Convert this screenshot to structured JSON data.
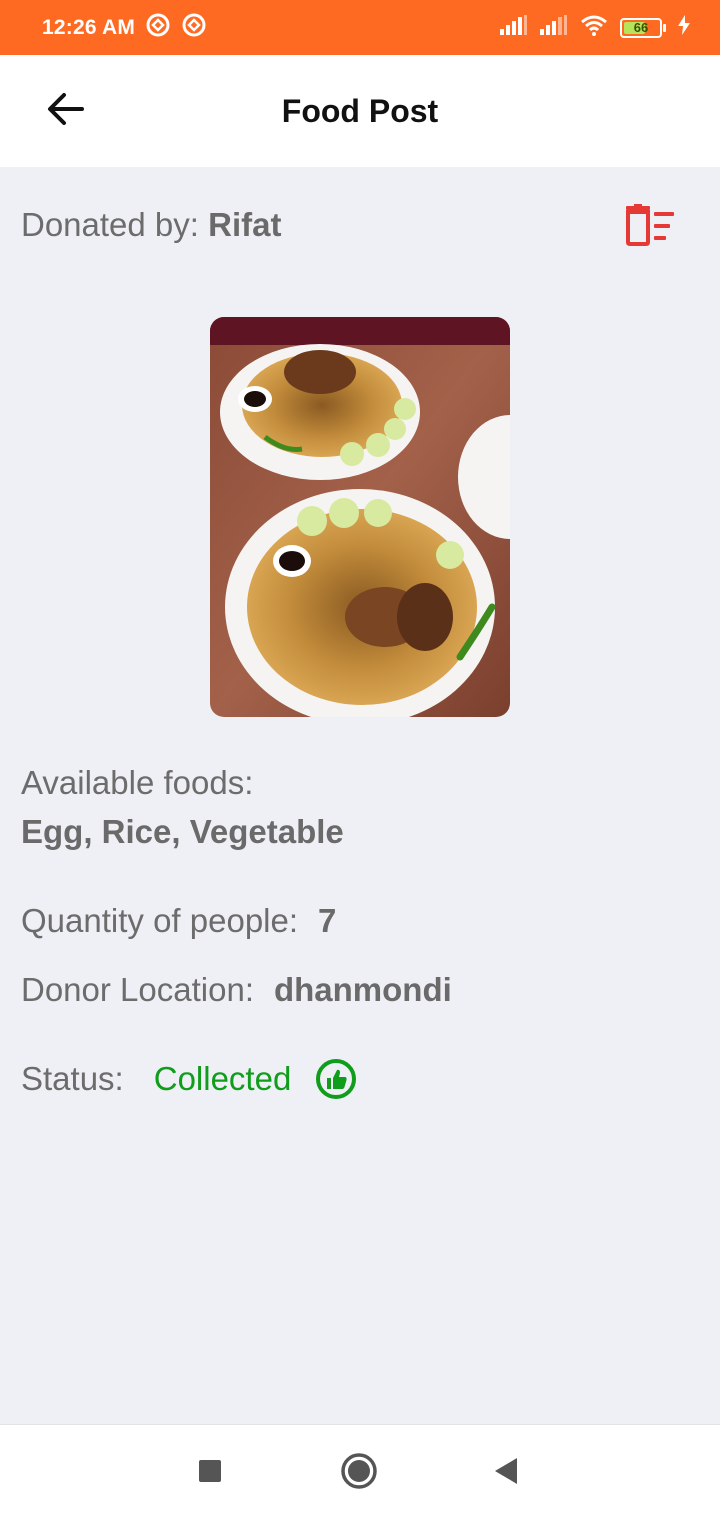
{
  "status_bar": {
    "time": "12:26 AM",
    "battery_level": "66",
    "icons": [
      "sync-icon",
      "sync-icon",
      "signal-icon",
      "signal-icon",
      "wifi-icon",
      "battery-icon",
      "charging-icon"
    ]
  },
  "app_bar": {
    "title": "Food Post",
    "back_icon": "arrow-left-icon"
  },
  "post": {
    "donated_label": "Donated by:",
    "donor_name": "Rifat",
    "delete_icon": "delete-list-icon",
    "available_label": "Available foods:",
    "available_value": "Egg, Rice, Vegetable",
    "quantity_label": "Quantity of people:",
    "quantity_value": "7",
    "location_label": "Donor Location:",
    "location_value": "dhanmondi",
    "status_label": "Status:",
    "status_value": "Collected",
    "status_icon": "thumbs-up-icon"
  },
  "colors": {
    "status_bar": "#ff6a22",
    "delete": "#e53935",
    "status_collected": "#0f9d1b",
    "background": "#eff0f5"
  },
  "nav_bar": {
    "icons": [
      "recents-square-icon",
      "home-circle-icon",
      "back-triangle-icon"
    ]
  }
}
